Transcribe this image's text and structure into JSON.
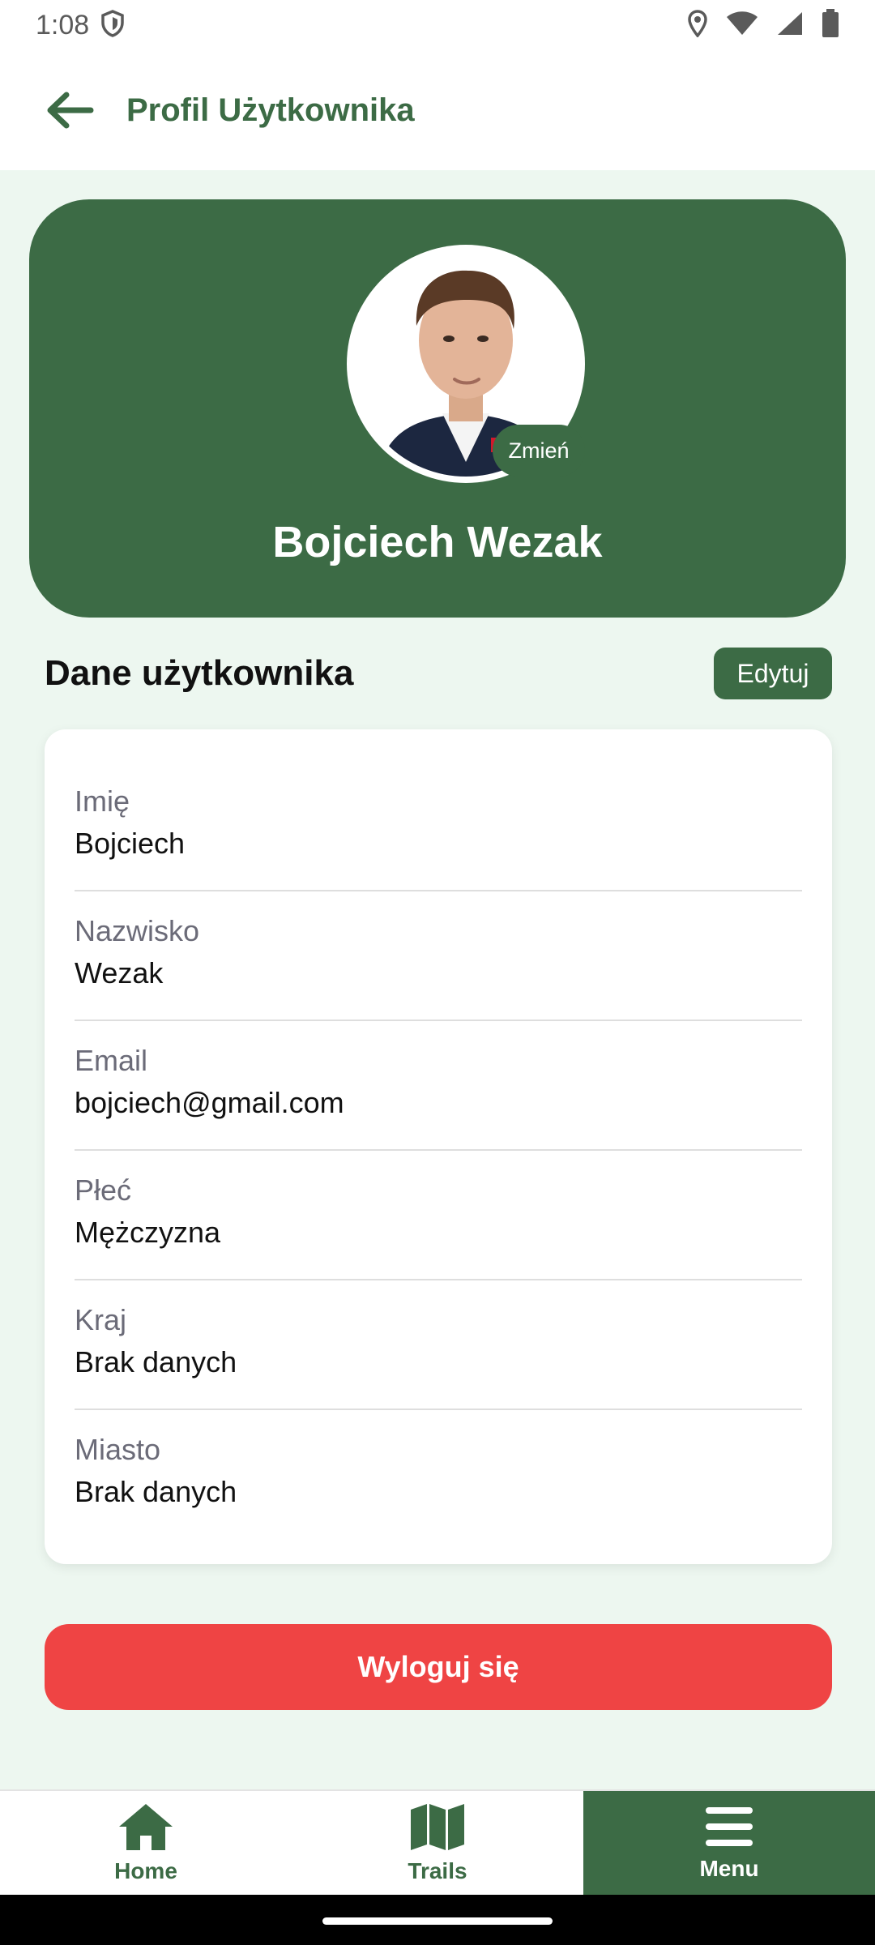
{
  "status_bar": {
    "time": "1:08",
    "icons": [
      "shield-icon",
      "location-icon",
      "wifi-icon",
      "signal-icon",
      "battery-icon"
    ]
  },
  "header": {
    "title": "Profil Użytkownika",
    "back_icon": "back-arrow-icon"
  },
  "profile": {
    "name": "Bojciech Wezak",
    "change_label": "Zmień"
  },
  "details": {
    "title": "Dane użytkownika",
    "edit_label": "Edytuj",
    "fields": [
      {
        "label": "Imię",
        "value": "Bojciech"
      },
      {
        "label": "Nazwisko",
        "value": "Wezak"
      },
      {
        "label": "Email",
        "value": "bojciech@gmail.com"
      },
      {
        "label": "Płeć",
        "value": "Mężczyzna"
      },
      {
        "label": "Kraj",
        "value": "Brak danych"
      },
      {
        "label": "Miasto",
        "value": "Brak danych"
      }
    ]
  },
  "logout_label": "Wyloguj się",
  "bottom_nav": {
    "items": [
      {
        "label": "Home",
        "icon": "home-icon"
      },
      {
        "label": "Trails",
        "icon": "map-icon"
      },
      {
        "label": "Menu",
        "icon": "menu-icon",
        "active": true
      }
    ]
  },
  "colors": {
    "primary": "#3c6b45",
    "background": "#edf7f0",
    "danger": "#ef4444"
  }
}
